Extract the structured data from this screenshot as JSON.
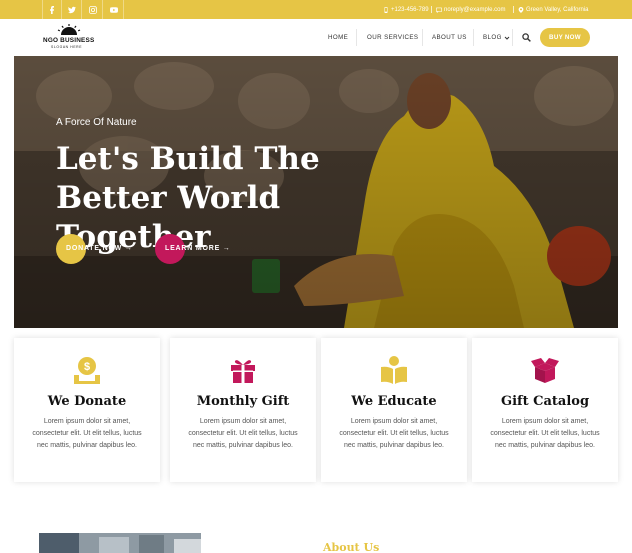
{
  "topbar": {
    "social": [
      "facebook-icon",
      "twitter-icon",
      "instagram-icon",
      "youtube-icon"
    ],
    "phone": "+123-456-789",
    "email": "noreply@example.com",
    "location": "Green Valley, California"
  },
  "header": {
    "logo_name": "NGO BUSINESS",
    "logo_slogan": "SLOGAN HERE",
    "nav": [
      "HOME",
      "OUR SERVICES",
      "ABOUT US",
      "BLOG"
    ],
    "buy_label": "BUY NOW"
  },
  "hero": {
    "kicker": "A Force Of Nature",
    "title": "Let's Build The Better World Together",
    "donate_label": "DONATE NOW →",
    "learn_label": "LEARN MORE →"
  },
  "features": [
    {
      "title": "We Donate",
      "text": "Lorem ipsum dolor sit amet, consectetur elit. Ut elit tellus, luctus nec mattis, pulvinar dapibus leo.",
      "icon": "donate-coin-icon"
    },
    {
      "title": "Monthly Gift",
      "text": "Lorem ipsum dolor sit amet, consectetur elit. Ut elit tellus, luctus nec mattis, pulvinar dapibus leo.",
      "icon": "gift-icon"
    },
    {
      "title": "We Educate",
      "text": "Lorem ipsum dolor sit amet, consectetur elit. Ut elit tellus, luctus nec mattis, pulvinar dapibus leo.",
      "icon": "education-icon"
    },
    {
      "title": "Gift Catalog",
      "text": "Lorem ipsum dolor sit amet, consectetur elit. Ut elit tellus, luctus nec mattis, pulvinar dapibus leo.",
      "icon": "open-box-icon"
    }
  ],
  "about": {
    "title": "About Us"
  },
  "colors": {
    "accent": "#e6c545",
    "secondary": "#c2185b"
  }
}
